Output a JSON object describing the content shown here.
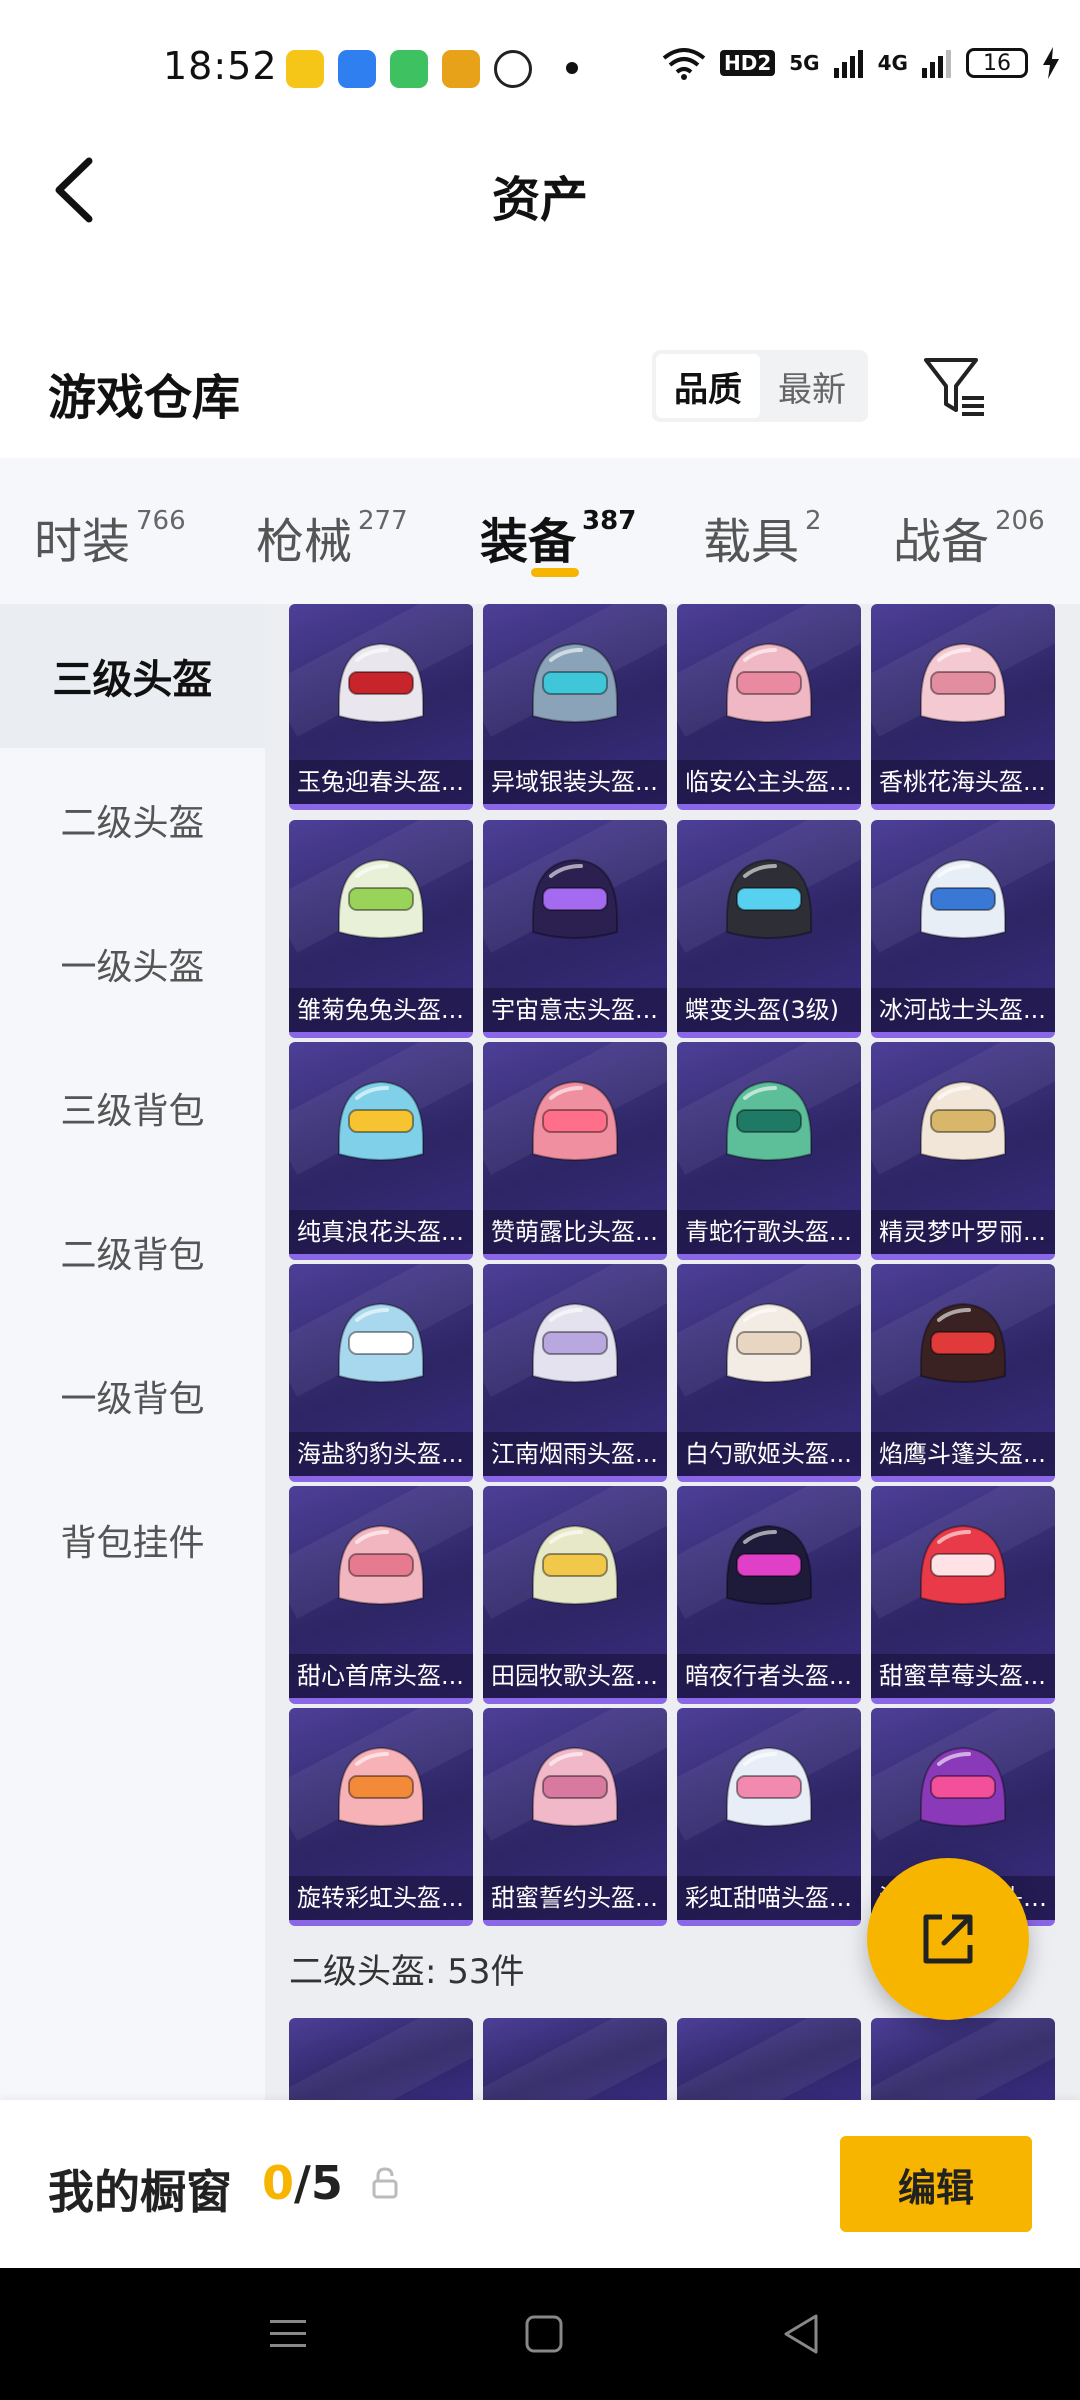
{
  "status_bar": {
    "time": "18:52",
    "network_5g": "5G",
    "network_4g": "4G",
    "hd_badge": "HD2",
    "battery": "16"
  },
  "header": {
    "title": "资产",
    "section_title": "游戏仓库",
    "sort_options": [
      "品质",
      "最新"
    ],
    "active_sort": "品质"
  },
  "category_tabs": [
    {
      "label": "时装",
      "count": "766"
    },
    {
      "label": "枪械",
      "count": "277"
    },
    {
      "label": "装备",
      "count": "387"
    },
    {
      "label": "载具",
      "count": "2"
    },
    {
      "label": "战备",
      "count": "206"
    }
  ],
  "active_category": "装备",
  "side_nav": [
    "三级头盔",
    "二级头盔",
    "一级头盔",
    "三级背包",
    "二级背包",
    "一级背包",
    "背包挂件"
  ],
  "active_side": "三级头盔",
  "items": [
    {
      "name": "玉兔迎春头盔...",
      "color": "#e9e6ee",
      "accent": "#c8242b"
    },
    {
      "name": "异域银装头盔...",
      "color": "#8aa3b8",
      "accent": "#3fc6d8"
    },
    {
      "name": "临安公主头盔...",
      "color": "#f0b8c4",
      "accent": "#e98aa0"
    },
    {
      "name": "香桃花海头盔...",
      "color": "#f5c9d2",
      "accent": "#e28da0"
    },
    {
      "name": "雏菊兔兔头盔...",
      "color": "#e8f0d8",
      "accent": "#9ad35a"
    },
    {
      "name": "宇宙意志头盔...",
      "color": "#2b2050",
      "accent": "#a46bf0"
    },
    {
      "name": "蝶变头盔(3级)",
      "color": "#2e2e36",
      "accent": "#58d0f0"
    },
    {
      "name": "冰河战士头盔...",
      "color": "#e8eef6",
      "accent": "#3a78d6"
    },
    {
      "name": "纯真浪花头盔...",
      "color": "#7fd0e8",
      "accent": "#f6c431"
    },
    {
      "name": "赞萌露比头盔...",
      "color": "#ef8fa0",
      "accent": "#ff6f8a"
    },
    {
      "name": "青蛇行歌头盔...",
      "color": "#5dbf9a",
      "accent": "#1e7a64"
    },
    {
      "name": "精灵梦叶罗丽...",
      "color": "#f2e6d8",
      "accent": "#d8b66a"
    },
    {
      "name": "海盐豹豹头盔...",
      "color": "#a8d8ee",
      "accent": "#ffffff"
    },
    {
      "name": "江南烟雨头盔...",
      "color": "#e4e2ee",
      "accent": "#b9a8e0"
    },
    {
      "name": "白勺歌姬头盔...",
      "color": "#f3ece4",
      "accent": "#e8d6c2"
    },
    {
      "name": "焰鹰斗篷头盔...",
      "color": "#3a2222",
      "accent": "#e03a3a"
    },
    {
      "name": "甜心首席头盔...",
      "color": "#f2b6c0",
      "accent": "#e67a8e"
    },
    {
      "name": "田园牧歌头盔...",
      "color": "#e6e8c8",
      "accent": "#f2c84a"
    },
    {
      "name": "暗夜行者头盔...",
      "color": "#1e1a3a",
      "accent": "#e040c8"
    },
    {
      "name": "甜蜜草莓头盔...",
      "color": "#e83a48",
      "accent": "#ffe2e6"
    },
    {
      "name": "旋转彩虹头盔...",
      "color": "#f7b2b8",
      "accent": "#f28a3a"
    },
    {
      "name": "甜蜜誓约头盔...",
      "color": "#f0b8c8",
      "accent": "#d87aa0"
    },
    {
      "name": "彩虹甜喵头盔...",
      "color": "#e8eef8",
      "accent": "#f28ab0"
    },
    {
      "name": "泡泡糖骑士头盔...",
      "color": "#8a3ab8",
      "accent": "#f2509a"
    }
  ],
  "group_label": "二级头盔: 53件",
  "bottom_bar": {
    "label": "我的橱窗",
    "current": "0",
    "total": "/5",
    "edit_label": "编辑"
  },
  "colors": {
    "accent": "#f7b500",
    "card_top": "#4d3f98",
    "card_bottom": "#2d2564"
  }
}
